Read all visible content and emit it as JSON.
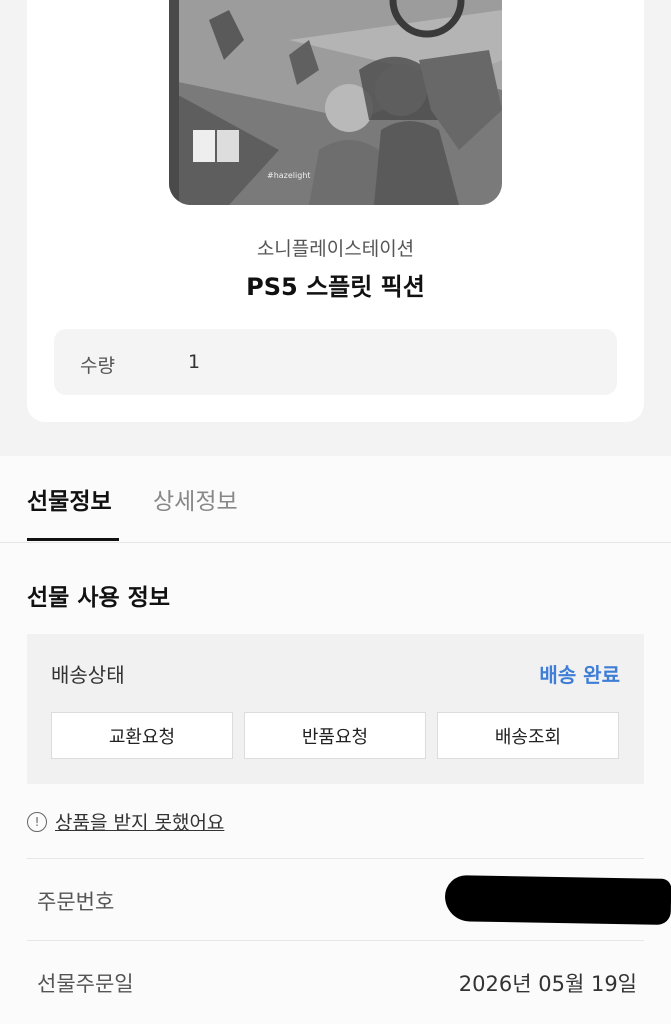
{
  "product": {
    "brand": "소니플레이스테이션",
    "name": "PS5 스플릿 픽션",
    "quantity_label": "수량",
    "quantity_value": "1",
    "cover_badge": "#hazelight"
  },
  "tabs": [
    {
      "label": "선물정보",
      "active": true
    },
    {
      "label": "상세정보",
      "active": false
    }
  ],
  "gift_usage": {
    "title": "선물 사용 정보",
    "delivery_status_label": "배송상태",
    "delivery_status_value": "배송 완료",
    "status_color": "#3f7ed6",
    "buttons": {
      "exchange": "교환요청",
      "return": "반품요청",
      "tracking": "배송조회"
    },
    "notice_icon": "!",
    "notice_link": "상품을 받지 못했어요"
  },
  "order": {
    "order_number_label": "주문번호",
    "order_number_value": "",
    "order_date_label": "선물주문일",
    "order_date_value": "2026년 05월 19일"
  }
}
